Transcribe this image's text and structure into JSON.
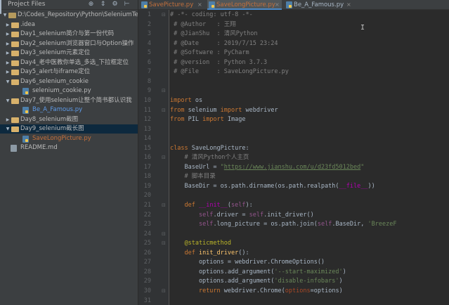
{
  "project_panel": {
    "title": "Project Files",
    "header_icons": [
      "globe-icon",
      "split-icon",
      "gear-icon",
      "hide-icon"
    ],
    "tree": [
      {
        "label": "D:\\Codes_Repository\\Python\\SeleniumTe",
        "kind": "root",
        "expanded": true,
        "depth": 0
      },
      {
        "label": ".idea",
        "kind": "folder",
        "expanded": false,
        "depth": 1
      },
      {
        "label": "Day1_selenium简介与第一份代码",
        "kind": "folder",
        "expanded": false,
        "depth": 1
      },
      {
        "label": "Day2_selenium浏览器窗口与Option操作",
        "kind": "folder",
        "expanded": false,
        "depth": 1
      },
      {
        "label": "Day3_selenium元素定位",
        "kind": "folder",
        "expanded": false,
        "depth": 1
      },
      {
        "label": "Day4_老中医教你单选_多选_下拉框定位",
        "kind": "folder",
        "expanded": false,
        "depth": 1
      },
      {
        "label": "Day5_alert与iframe定位",
        "kind": "folder",
        "expanded": false,
        "depth": 1
      },
      {
        "label": "Day6_selenium_cookie",
        "kind": "folder",
        "expanded": true,
        "depth": 1
      },
      {
        "label": "selenium_cookie.py",
        "kind": "py",
        "depth": 2
      },
      {
        "label": "Day7_使用selenium让整个简书都认识我",
        "kind": "folder",
        "expanded": true,
        "depth": 1
      },
      {
        "label": "Be_A_Famous.py",
        "kind": "py",
        "depth": 2,
        "color": "#5f9be8"
      },
      {
        "label": "Day8_selenium截图",
        "kind": "folder",
        "expanded": false,
        "depth": 1
      },
      {
        "label": "Day9_selenium截长图",
        "kind": "folder",
        "expanded": true,
        "depth": 1,
        "selected": true
      },
      {
        "label": "SaveLongPicture.py",
        "kind": "py",
        "depth": 2,
        "color": "#c4703c"
      },
      {
        "label": "README.md",
        "kind": "md",
        "depth": 1
      }
    ]
  },
  "tabs": [
    {
      "label": "SavePicture.py",
      "active": false,
      "color": "#c4703c"
    },
    {
      "label": "SaveLongPicture.py",
      "active": true,
      "color": "#c4703c"
    },
    {
      "label": "Be_A_Famous.py",
      "active": false,
      "color": "#a9b7c6"
    }
  ],
  "editor": {
    "line_numbers": [
      "1",
      "2",
      "3",
      "4",
      "5",
      "6",
      "7",
      "8",
      "9",
      "10",
      "11",
      "12",
      "13",
      "14",
      "15",
      "16",
      "17",
      "18",
      "19",
      "20",
      "21",
      "22",
      "23",
      "24",
      "25",
      "26",
      "27",
      "28",
      "29",
      "30",
      "31"
    ],
    "fold_markers": {
      "1": "⊟",
      "9": "⊟",
      "11": "⊟",
      "16": "⊟",
      "21": "⊟",
      "24": "⊟",
      "25": "⊟",
      "30": "⊟"
    },
    "lines": [
      [
        [
          "c",
          "# -*- coding: utf-8 -*-"
        ]
      ],
      [
        [
          "c",
          " # @Author   : 王翔"
        ]
      ],
      [
        [
          "c",
          " # @JianShu  : 清风Python"
        ]
      ],
      [
        [
          "c",
          " # @Date     : 2019/7/15 23:24"
        ]
      ],
      [
        [
          "c",
          " # @Software : PyCharm"
        ]
      ],
      [
        [
          "c",
          " # @version  : Python 3.7.3"
        ]
      ],
      [
        [
          "c",
          " # @File     : SaveLongPicture.py"
        ]
      ],
      [],
      [],
      [
        [
          "k",
          "import"
        ],
        [
          "t",
          " os"
        ]
      ],
      [
        [
          "k",
          "from"
        ],
        [
          "t",
          " selenium "
        ],
        [
          "k",
          "import"
        ],
        [
          "t",
          " webdriver"
        ]
      ],
      [
        [
          "k",
          "from"
        ],
        [
          "t",
          " PIL "
        ],
        [
          "k",
          "import"
        ],
        [
          "t",
          " Image"
        ]
      ],
      [],
      [],
      [
        [
          "k",
          "class"
        ],
        [
          "t",
          " SaveLongPicture:"
        ]
      ],
      [
        [
          "t",
          "    "
        ],
        [
          "c",
          "# 清风Python个人主页"
        ]
      ],
      [
        [
          "t",
          "    BaseUrl = "
        ],
        [
          "s",
          "\""
        ],
        [
          "u",
          "https://www.jianshu.com/u/d23fd5012bed"
        ],
        [
          "s",
          "\""
        ]
      ],
      [
        [
          "t",
          "    "
        ],
        [
          "c",
          "# 脚本目录"
        ]
      ],
      [
        [
          "t",
          "    BaseDir = os.path.dirname(os.path.realpath("
        ],
        [
          "mg",
          "__file__"
        ],
        [
          "t",
          "))"
        ]
      ],
      [],
      [
        [
          "t",
          "    "
        ],
        [
          "k",
          "def"
        ],
        [
          "t",
          " "
        ],
        [
          "mg",
          "__init__"
        ],
        [
          "t",
          "("
        ],
        [
          "self",
          "self"
        ],
        [
          "t",
          "):"
        ]
      ],
      [
        [
          "t",
          "        "
        ],
        [
          "self",
          "self"
        ],
        [
          "t",
          ".driver = "
        ],
        [
          "self",
          "self"
        ],
        [
          "t",
          ".init_driver()"
        ]
      ],
      [
        [
          "t",
          "        "
        ],
        [
          "self",
          "self"
        ],
        [
          "t",
          ".long_picture = os.path.join("
        ],
        [
          "self",
          "self"
        ],
        [
          "t",
          ".BaseDir, "
        ],
        [
          "s",
          "'BreezeF"
        ]
      ],
      [],
      [
        [
          "t",
          "    "
        ],
        [
          "dec",
          "@staticmethod"
        ]
      ],
      [
        [
          "t",
          "    "
        ],
        [
          "k",
          "def"
        ],
        [
          "t",
          " "
        ],
        [
          "fn",
          "init_driver"
        ],
        [
          "t",
          "():"
        ]
      ],
      [
        [
          "t",
          "        options = webdriver.ChromeOptions()"
        ]
      ],
      [
        [
          "t",
          "        options.add_argument("
        ],
        [
          "s",
          "'--start-maximized'"
        ],
        [
          "t",
          ")"
        ]
      ],
      [
        [
          "t",
          "        options.add_argument("
        ],
        [
          "s",
          "'disable-infobars'"
        ],
        [
          "t",
          ")"
        ]
      ],
      [
        [
          "t",
          "        "
        ],
        [
          "k",
          "return"
        ],
        [
          "t",
          " webdriver.Chrome("
        ],
        [
          "prm",
          "options"
        ],
        [
          "t",
          "=options)"
        ]
      ],
      []
    ]
  },
  "cursor_glyph": "I"
}
